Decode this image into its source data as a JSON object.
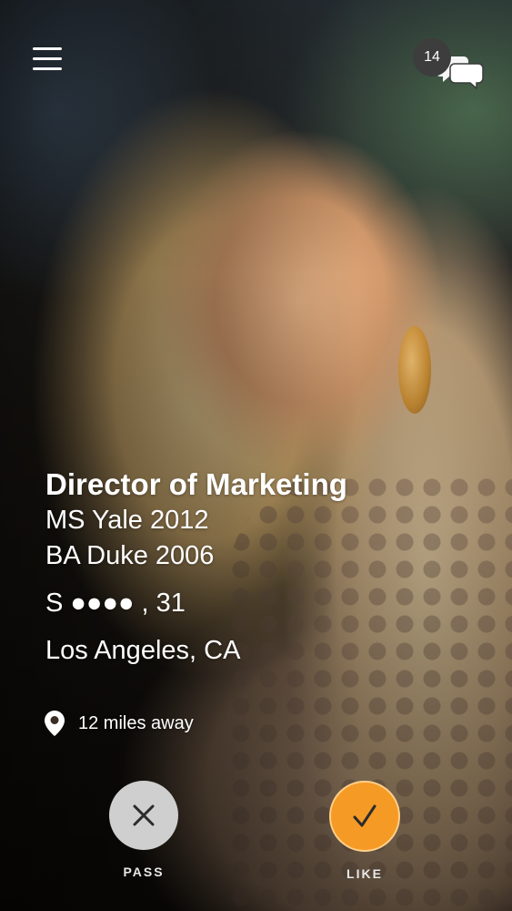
{
  "header": {
    "menu_icon": "hamburger-menu-icon",
    "chat_icon": "chat-bubbles-icon",
    "message_count": "14"
  },
  "profile": {
    "job_title": "Director of Marketing",
    "education": [
      "MS Yale 2012",
      "BA Duke 2006"
    ],
    "status_prefix": "S",
    "status_dots": "●●●●",
    "age_text": ", 31",
    "location": "Los Angeles, CA",
    "distance": "12 miles away",
    "distance_icon": "location-pin-icon"
  },
  "actions": {
    "pass_label": "PASS",
    "pass_icon": "close-icon",
    "like_label": "LIKE",
    "like_icon": "checkmark-icon"
  },
  "colors": {
    "like": "#f59a25",
    "pass": "#cfcfcf",
    "badge": "#3d3d3d",
    "text": "#ffffff"
  }
}
